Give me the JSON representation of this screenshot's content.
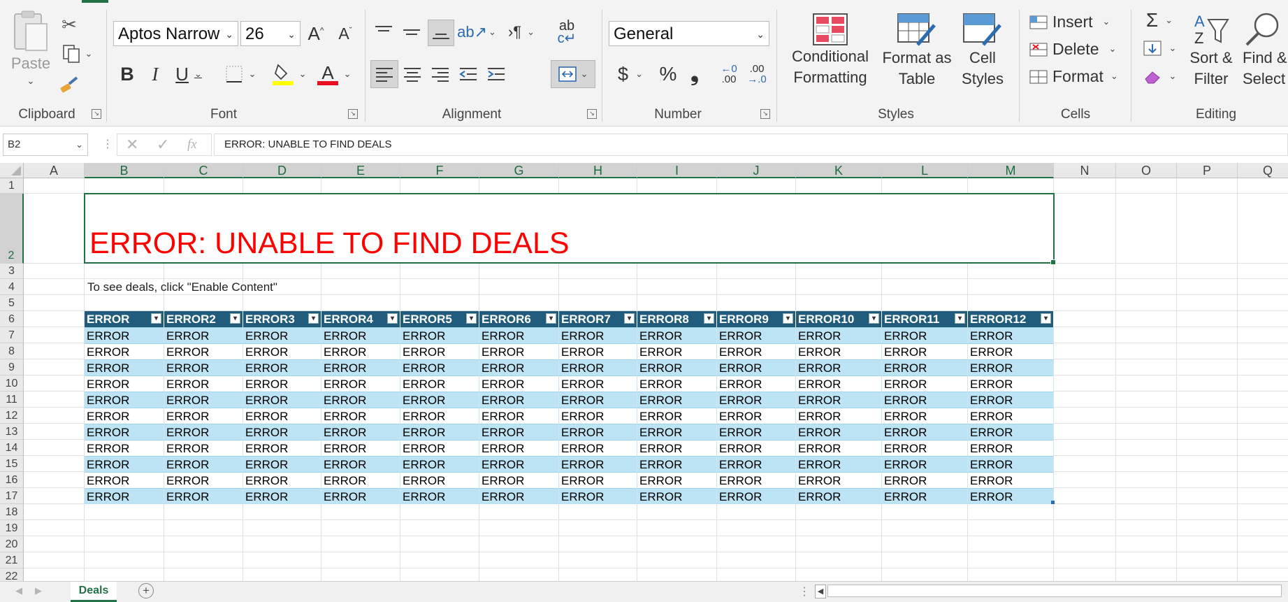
{
  "ribbon": {
    "clipboard": {
      "label": "Clipboard",
      "paste_label": "Paste"
    },
    "font": {
      "label": "Font",
      "font_name": "Aptos Narrow",
      "font_size": "26",
      "bold": "B",
      "italic": "I",
      "underline": "U"
    },
    "alignment": {
      "label": "Alignment"
    },
    "number": {
      "label": "Number",
      "format": "General",
      "currency": "$",
      "percent": "%",
      "comma": "❟",
      "inc_decimal": ".00",
      "dec_decimal": ".00"
    },
    "styles": {
      "label": "Styles",
      "conditional_formatting_line1": "Conditional",
      "conditional_formatting_line2": "Formatting",
      "format_as_table_line1": "Format as",
      "format_as_table_line2": "Table",
      "cell_styles_line1": "Cell",
      "cell_styles_line2": "Styles"
    },
    "cells": {
      "label": "Cells",
      "insert": "Insert",
      "delete": "Delete",
      "format": "Format"
    },
    "editing": {
      "label": "Editing",
      "sort_filter_line1": "Sort &",
      "sort_filter_line2": "Filter",
      "find_select_line1": "Find &",
      "find_select_line2": "Select"
    }
  },
  "formula_bar": {
    "name_box": "B2",
    "fx": "fx",
    "formula": "ERROR: UNABLE TO FIND DEALS"
  },
  "grid": {
    "columns": [
      "A",
      "B",
      "C",
      "D",
      "E",
      "F",
      "G",
      "H",
      "I",
      "J",
      "K",
      "L",
      "M",
      "N",
      "O",
      "P",
      "Q"
    ],
    "rows": [
      "1",
      "2",
      "3",
      "4",
      "5",
      "6",
      "7",
      "8",
      "9",
      "10",
      "11",
      "12",
      "13",
      "14",
      "15",
      "16",
      "17",
      "18",
      "19",
      "20",
      "21",
      "22"
    ],
    "title": "ERROR: UNABLE TO FIND DEALS",
    "instruction": "To see deals, click \"Enable Content\"",
    "table_headers": [
      "ERROR",
      "ERROR2",
      "ERROR3",
      "ERROR4",
      "ERROR5",
      "ERROR6",
      "ERROR7",
      "ERROR8",
      "ERROR9",
      "ERROR10",
      "ERROR11",
      "ERROR12"
    ],
    "cell_value": "ERROR",
    "data_row_count": 11
  },
  "sheets": {
    "active": "Deals"
  },
  "colors": {
    "accent": "#217346",
    "title_red": "#ff0000",
    "table_header": "#215c7c",
    "band_light": "#bde4f4"
  }
}
